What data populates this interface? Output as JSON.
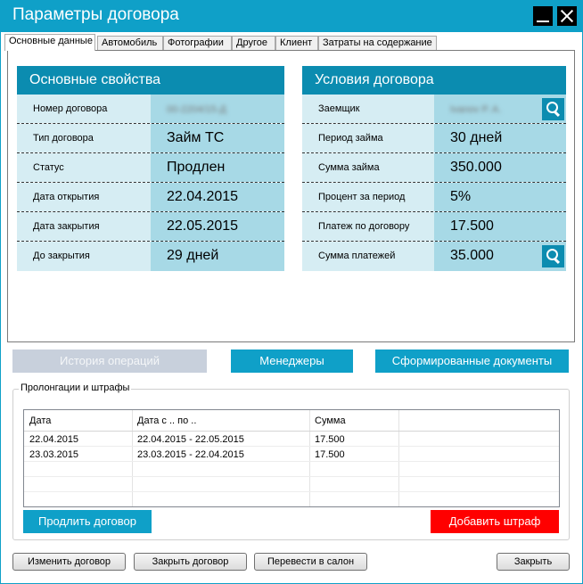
{
  "window": {
    "title": "Параметры договора"
  },
  "tabs": [
    "Основные данные",
    "Автомобиль",
    "Фотографии",
    "Другое",
    "Клиент",
    "Затраты на содержание"
  ],
  "main_props": {
    "header": "Основные свойства",
    "rows": [
      {
        "label": "Номер договора",
        "value": "00-2204/15-Д"
      },
      {
        "label": "Тип договора",
        "value": "Займ ТС"
      },
      {
        "label": "Статус",
        "value": "Продлен"
      },
      {
        "label": "Дата открытия",
        "value": "22.04.2015"
      },
      {
        "label": "Дата закрытия",
        "value": "22.05.2015"
      },
      {
        "label": "До закрытия",
        "value": "29 дней"
      }
    ]
  },
  "terms": {
    "header": "Условия договора",
    "rows": [
      {
        "label": "Заемщик",
        "value": "Ivanov P. A."
      },
      {
        "label": "Период займа",
        "value": "30 дней"
      },
      {
        "label": "Сумма займа",
        "value": "350.000"
      },
      {
        "label": "Процент за период",
        "value": "5%"
      },
      {
        "label": "Платеж по договору",
        "value": "17.500"
      },
      {
        "label": "Сумма платежей",
        "value": "35.000"
      }
    ]
  },
  "action_buttons": {
    "history": "История операций",
    "managers": "Менеджеры",
    "documents": "Сформированные документы"
  },
  "prolongations": {
    "title": "Пролонгации и штрафы",
    "columns": [
      "Дата",
      "Дата с .. по ..",
      "Сумма"
    ],
    "rows": [
      [
        "22.04.2015",
        "22.04.2015 - 22.05.2015",
        "17.500"
      ],
      [
        "23.03.2015",
        "23.03.2015 - 22.04.2015",
        "17.500"
      ]
    ],
    "extend_button": "Продлить договор",
    "penalty_button": "Добавить штраф"
  },
  "footer": {
    "edit": "Изменить договор",
    "close_contract": "Закрыть договор",
    "transfer": "Перевести в салон",
    "close": "Закрыть"
  },
  "colors": {
    "accent": "#0fa0c8",
    "panel_header": "#0b8cb0",
    "label_bg": "#d6edf3",
    "value_bg": "#a7d9e6",
    "disabled_button": "#c8d0dc",
    "danger": "#ff0000"
  },
  "icons": {
    "search": "search-icon"
  }
}
